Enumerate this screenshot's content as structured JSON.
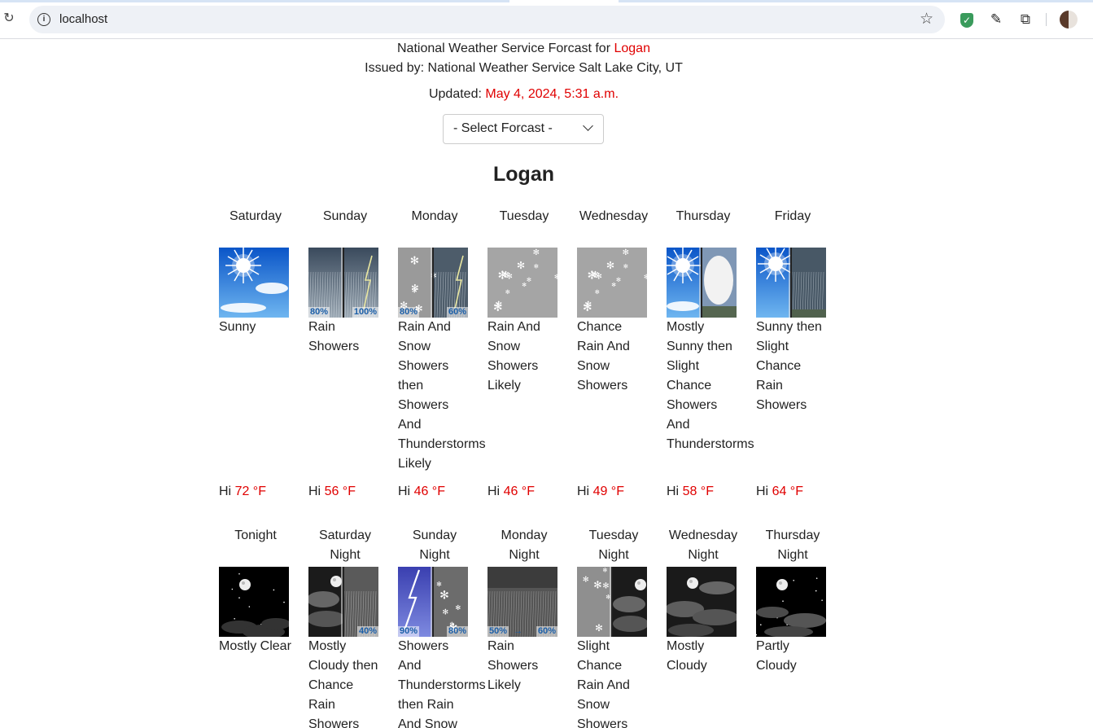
{
  "browser": {
    "url": "localhost"
  },
  "header": {
    "title_prefix": "National Weather Service Forcast for ",
    "title_city": "Logan",
    "issued_by": "Issued by: National Weather Service Salt Lake City, UT",
    "updated_label": "Updated: ",
    "updated_value": "May 4, 2024, 5:31 a.m."
  },
  "forecast_select": {
    "label": "- Select Forcast -"
  },
  "city": "Logan",
  "day_periods": [
    {
      "name": "Saturday",
      "icon": "sunny",
      "desc": "Sunny",
      "hi_label": "Hi",
      "temp": "72 °F"
    },
    {
      "name": "Sunday",
      "icon": "rain-showers-thunder",
      "pct_left": "80%",
      "pct_right": "100%",
      "desc": "Rain Showers",
      "hi_label": "Hi",
      "temp": "56 °F"
    },
    {
      "name": "Monday",
      "icon": "snow-thunder",
      "pct_left": "80%",
      "pct_right": "60%",
      "desc": "Rain And Snow Showers then Showers And Thunderstorms Likely",
      "hi_label": "Hi",
      "temp": "46 °F"
    },
    {
      "name": "Tuesday",
      "icon": "snow",
      "desc": "Rain And Snow Showers Likely",
      "hi_label": "Hi",
      "temp": "46 °F"
    },
    {
      "name": "Wednesday",
      "icon": "snow",
      "desc": "Chance Rain And Snow Showers",
      "hi_label": "Hi",
      "temp": "49 °F"
    },
    {
      "name": "Thursday",
      "icon": "sun-then-storm",
      "desc": "Mostly Sunny then Slight Chance Showers And Thunderstorms",
      "hi_label": "Hi",
      "temp": "58 °F"
    },
    {
      "name": "Friday",
      "icon": "sun-then-rain",
      "desc": "Sunny then Slight Chance Rain Showers",
      "hi_label": "Hi",
      "temp": "64 °F"
    }
  ],
  "night_periods": [
    {
      "name": "Tonight",
      "icon": "clear-night",
      "desc": "Mostly Clear"
    },
    {
      "name": "Saturday Night",
      "icon": "cloudy-night-rain",
      "pct_right": "40%",
      "desc": "Mostly Cloudy then Chance Rain Showers"
    },
    {
      "name": "Sunday Night",
      "icon": "lightning-snow",
      "pct_left": "90%",
      "pct_right": "80%",
      "desc": "Showers And Thunderstorms then Rain And Snow"
    },
    {
      "name": "Monday Night",
      "icon": "rain-night",
      "pct_left": "50%",
      "pct_arrow": "→",
      "pct_right": "60%",
      "desc": "Rain Showers Likely"
    },
    {
      "name": "Tuesday Night",
      "icon": "snow-then-night",
      "desc": "Slight Chance Rain And Snow Showers"
    },
    {
      "name": "Wednesday Night",
      "icon": "cloudy-night",
      "desc": "Mostly Cloudy"
    },
    {
      "name": "Thursday Night",
      "icon": "partly-cloudy-night",
      "desc": "Partly Cloudy"
    }
  ]
}
